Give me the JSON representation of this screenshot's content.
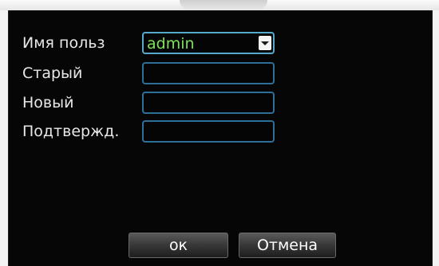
{
  "form": {
    "username_label": "Имя польз",
    "username_value": "admin",
    "old_password_label": "Старый",
    "new_password_label": "Новый",
    "confirm_label": "Подтвержд.",
    "old_password_value": "",
    "new_password_value": "",
    "confirm_value": ""
  },
  "buttons": {
    "ok_label": "ок",
    "cancel_label": "Отмена"
  },
  "colors": {
    "field_border": "#2e6f9a",
    "selected_text": "#7ee15b",
    "dialog_bg": "#060606"
  },
  "icons": {
    "dropdown": "chevron-down-icon"
  }
}
